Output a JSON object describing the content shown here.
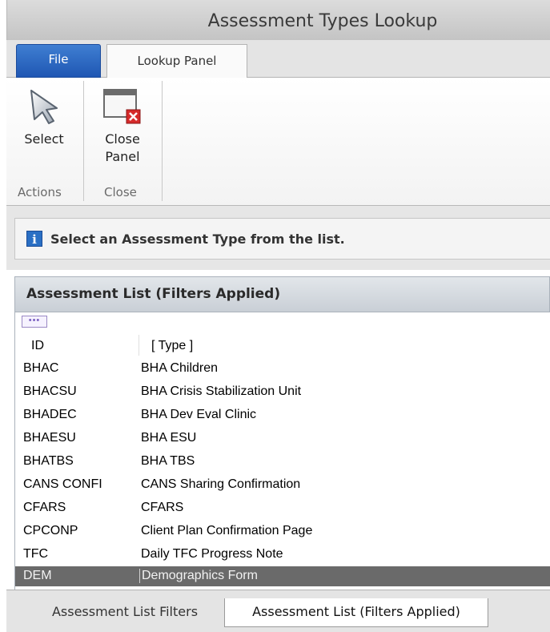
{
  "window": {
    "title": "Assessment Types Lookup"
  },
  "ribbon_tabs": {
    "file": "File",
    "lookup_panel": "Lookup Panel"
  },
  "ribbon": {
    "select_label": "Select",
    "close_label_line1": "Close",
    "close_label_line2": "Panel",
    "group_actions": "Actions",
    "group_close": "Close"
  },
  "hint": {
    "text": "Select an Assessment Type from the list."
  },
  "panel": {
    "title": "Assessment List (Filters Applied)",
    "ellipsis": "•••"
  },
  "grid": {
    "columns": [
      "ID",
      "[ Type ]"
    ],
    "rows": [
      {
        "id": "BHAC",
        "type": "BHA Children"
      },
      {
        "id": "BHACSU",
        "type": "BHA Crisis Stabilization Unit"
      },
      {
        "id": "BHADEC",
        "type": "BHA Dev Eval Clinic"
      },
      {
        "id": "BHAESU",
        "type": "BHA ESU"
      },
      {
        "id": "BHATBS",
        "type": "BHA TBS"
      },
      {
        "id": "CANS CONFI",
        "type": "CANS Sharing Confirmation"
      },
      {
        "id": "CFARS",
        "type": "CFARS"
      },
      {
        "id": "CPCONP",
        "type": "Client Plan Confirmation Page"
      },
      {
        "id": "TFC",
        "type": "Daily TFC Progress Note"
      },
      {
        "id": "DEM",
        "type": "Demographics Form"
      }
    ],
    "selected_row_index": 9
  },
  "bottom_tabs": {
    "filters": "Assessment List Filters",
    "applied": "Assessment List (Filters Applied)"
  },
  "icons": {
    "select": "cursor-arrow-icon",
    "close": "close-panel-icon",
    "info": "info-icon"
  },
  "colors": {
    "file_tab": "#2a66c0",
    "selected_row": "#6a6a6a",
    "info_icon": "#2a6fc4",
    "close_x": "#d62a2a"
  }
}
